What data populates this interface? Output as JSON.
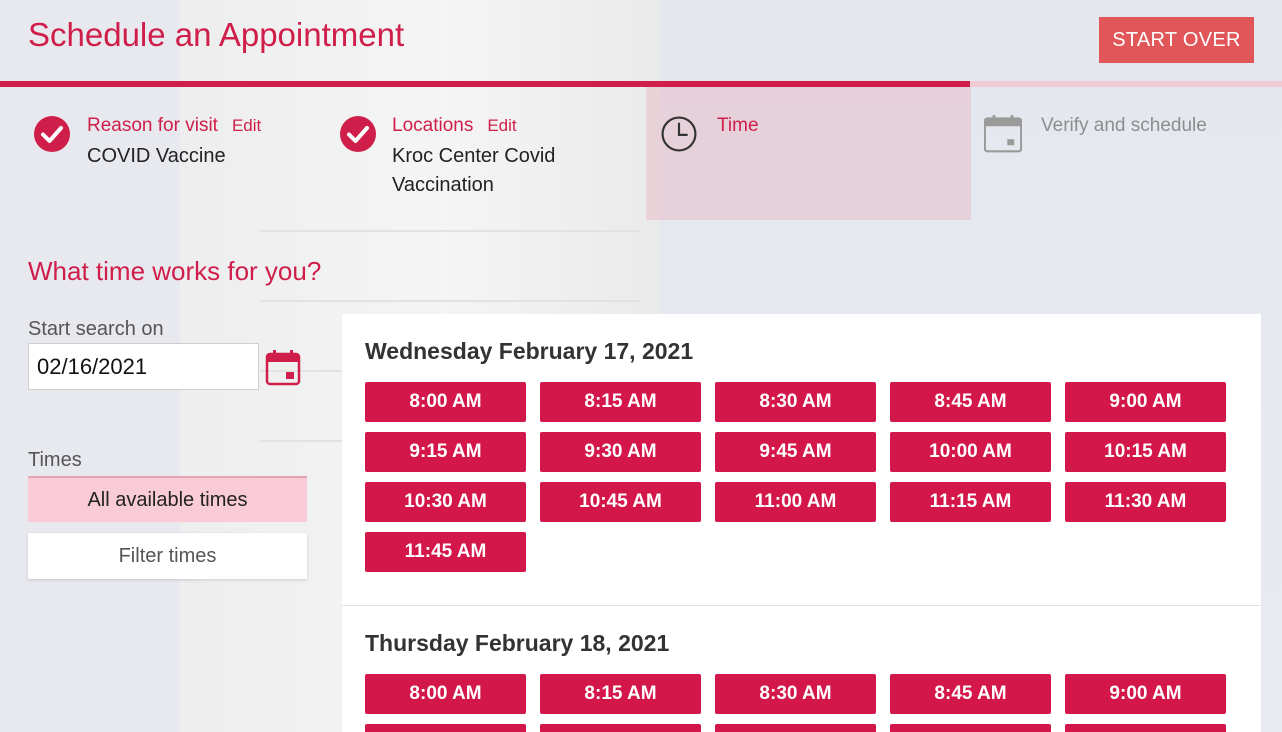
{
  "header": {
    "title": "Schedule an Appointment",
    "start_over_label": "START OVER"
  },
  "steps": [
    {
      "label": "Reason for visit",
      "edit": "Edit",
      "value": "COVID Vaccine",
      "status": "complete"
    },
    {
      "label": "Locations",
      "edit": "Edit",
      "value": "Kroc Center Covid Vaccination",
      "status": "complete"
    },
    {
      "label": "Time",
      "status": "active"
    },
    {
      "label": "Verify and schedule",
      "status": "pending"
    }
  ],
  "question": "What time works for you?",
  "search": {
    "label": "Start search on",
    "date_value": "02/16/2021"
  },
  "times_filter": {
    "label": "Times",
    "all_label": "All available times",
    "filter_label": "Filter times"
  },
  "days": [
    {
      "date": "Wednesday February 17, 2021",
      "slots": [
        "8:00 AM",
        "8:15 AM",
        "8:30 AM",
        "8:45 AM",
        "9:00 AM",
        "9:15 AM",
        "9:30 AM",
        "9:45 AM",
        "10:00 AM",
        "10:15 AM",
        "10:30 AM",
        "10:45 AM",
        "11:00 AM",
        "11:15 AM",
        "11:30 AM",
        "11:45 AM"
      ]
    },
    {
      "date": "Thursday February 18, 2021",
      "slots": [
        "8:00 AM",
        "8:15 AM",
        "8:30 AM",
        "8:45 AM",
        "9:00 AM",
        "",
        "",
        "",
        "",
        ""
      ]
    }
  ],
  "colors": {
    "brand": "#d01e4a",
    "start_over": "#e15659",
    "slot": "#d4174a",
    "active_step": "#f0cbd4"
  },
  "icons": {
    "complete": "check-circle-icon",
    "active": "clock-icon",
    "pending": "calendar-icon",
    "date_picker": "calendar-icon"
  }
}
